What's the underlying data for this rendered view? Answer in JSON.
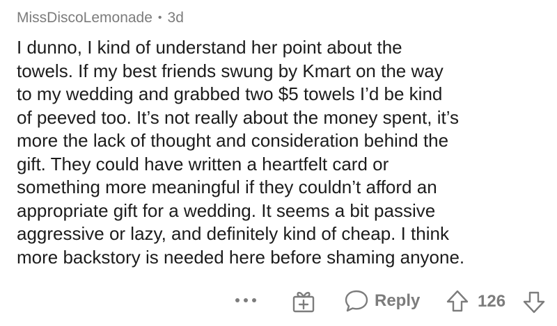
{
  "comment": {
    "author": "MissDiscoLemonade",
    "separator": "•",
    "age": "3d",
    "body_lines": [
      "I dunno, I kind of understand her point about the",
      "towels. If my best friends swung by Kmart on the way",
      "to my wedding and grabbed two $5 towels I’d be kind",
      "of peeved too. It’s not really about the money spent, it’s",
      "more the lack of thought and consideration behind the",
      "gift. They could have written a heartfelt card or",
      "something more meaningful if they couldn’t afford an",
      "appropriate gift for a wedding.  It seems a bit passive",
      "aggressive or lazy, and definitely kind of cheap. I think",
      "more backstory is needed here before shaming anyone."
    ]
  },
  "actions": {
    "more_label": "•••",
    "more_icon": "more-options-icon",
    "award_icon": "gift-icon",
    "reply_icon": "speech-bubble-icon",
    "reply_label": "Reply",
    "upvote_icon": "arrow-up-icon",
    "score": "126",
    "downvote_icon": "arrow-down-icon"
  },
  "colors": {
    "text": "#1c1c1c",
    "muted": "#7c7c7c",
    "background": "#ffffff"
  }
}
